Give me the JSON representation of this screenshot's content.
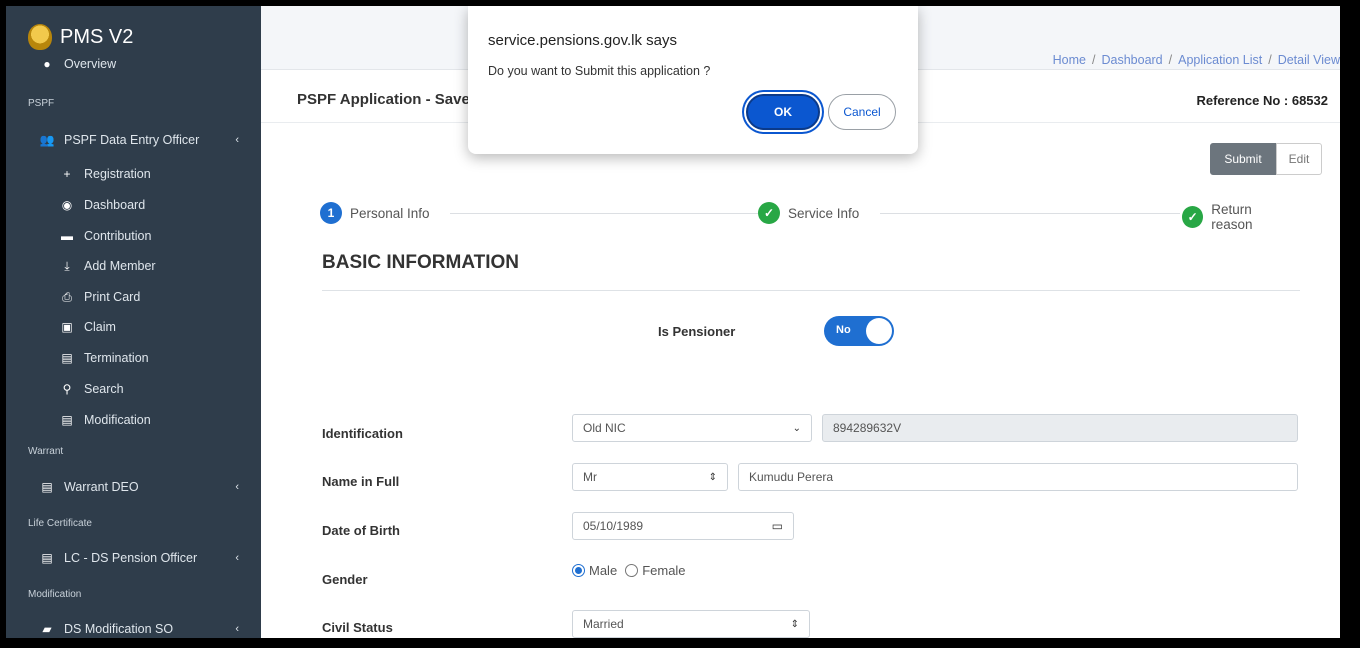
{
  "sidebar": {
    "brand": "PMS V2",
    "overview": "Overview",
    "sections": {
      "pspf": "PSPF",
      "warrant": "Warrant",
      "life_certificate": "Life Certificate",
      "modification": "Modification"
    },
    "pspf_group": "PSPF Data Entry Officer",
    "pspf_items": [
      "Registration",
      "Dashboard",
      "Contribution",
      "Add Member",
      "Print Card",
      "Claim",
      "Termination",
      "Search",
      "Modification"
    ],
    "warrant_group": "Warrant DEO",
    "lc_group": "LC - DS Pension Officer",
    "mod_group": "DS Modification SO"
  },
  "breadcrumb": [
    "Home",
    "Dashboard",
    "Application List",
    "Detail View"
  ],
  "page": {
    "title": "PSPF Application - Save",
    "reference": "Reference No : 68532",
    "submit_label": "Submit",
    "edit_label": "Edit"
  },
  "stepper": {
    "steps": [
      {
        "label": "Personal Info",
        "marker": "1"
      },
      {
        "label": "Service Info",
        "marker": "✓"
      },
      {
        "label": "Return reason",
        "marker": "✓"
      }
    ]
  },
  "form": {
    "section_title": "BASIC INFORMATION",
    "is_pensioner_label": "Is Pensioner",
    "is_pensioner_value": "No",
    "identification_label": "Identification",
    "identification_type": "Old NIC",
    "identification_number": "894289632V",
    "name_label": "Name in Full",
    "title_value": "Mr",
    "name_value": "Kumudu Perera",
    "dob_label": "Date of Birth",
    "dob_value": "05/10/1989",
    "gender_label": "Gender",
    "gender_options": [
      "Male",
      "Female"
    ],
    "gender_selected": "Male",
    "civil_label": "Civil Status",
    "civil_value": "Married"
  },
  "dialog": {
    "title": "service.pensions.gov.lk says",
    "message": "Do you want to Submit this application ?",
    "ok_label": "OK",
    "cancel_label": "Cancel"
  },
  "colors": {
    "sidebar_bg": "#2f3d4b",
    "primary": "#1f6fd1",
    "success": "#28a745",
    "dialog_ok": "#0b57d0"
  }
}
